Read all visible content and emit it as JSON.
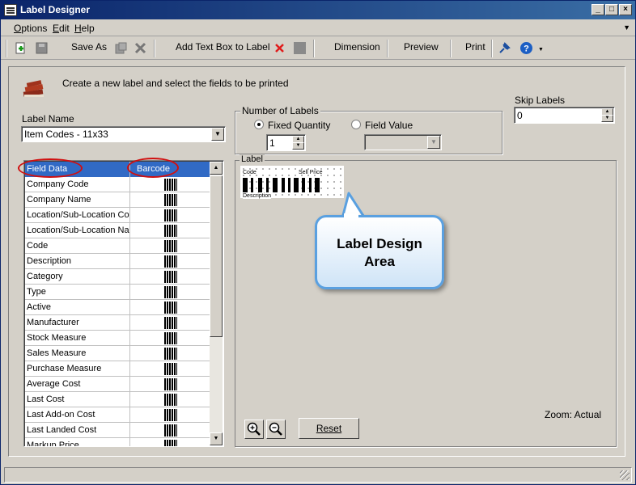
{
  "window": {
    "title": "Label Designer"
  },
  "menu": [
    {
      "label": "Options",
      "u": "O",
      "rest": "ptions"
    },
    {
      "label": "Edit",
      "u": "E",
      "rest": "dit"
    },
    {
      "label": "Help",
      "u": "H",
      "rest": "elp"
    }
  ],
  "toolbar": {
    "save_as": "Save As",
    "add_text_box": "Add Text Box to Label",
    "dimension": "Dimension",
    "preview": "Preview",
    "print": "Print"
  },
  "intro": "Create a new label and select the fields to be printed",
  "label_name": {
    "caption": "Label Name",
    "value": "Item Codes - 11x33"
  },
  "number_of_labels": {
    "caption": "Number of Labels",
    "fixed_quantity": "Fixed Quantity",
    "field_value": "Field Value",
    "quantity": "1",
    "selected": "fixed_quantity"
  },
  "skip_labels": {
    "caption": "Skip Labels",
    "value": "0"
  },
  "fields_grid": {
    "header": {
      "field": "Field Data",
      "barcode": "Barcode"
    },
    "rows": [
      "Company Code",
      "Company Name",
      "Location/Sub-Location Code",
      "Location/Sub-Location Name",
      "Code",
      "Description",
      "Category",
      "Type",
      "Active",
      "Manufacturer",
      "Stock Measure",
      "Sales Measure",
      "Purchase Measure",
      "Average Cost",
      "Last Cost",
      "Last Add-on Cost",
      "Last Landed Cost",
      "Markup Price"
    ]
  },
  "label_area": {
    "caption": "Label",
    "canvas": {
      "code": "Code",
      "sell_price": "Sell Price",
      "description": "Description"
    }
  },
  "callout": {
    "line1": "Label Design",
    "line2": "Area"
  },
  "zoom": "Zoom: Actual",
  "reset": "Reset",
  "colors": {
    "selection": "#316ac5",
    "annotation": "#d01010",
    "callout_border": "#5aa0e0"
  }
}
